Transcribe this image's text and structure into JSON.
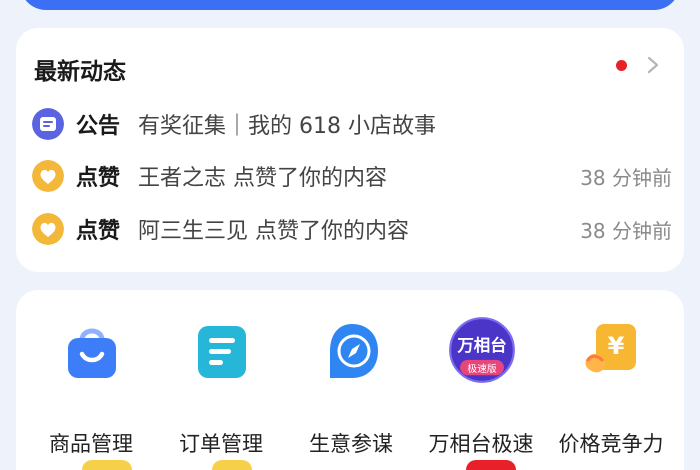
{
  "activity": {
    "title": "最新动态",
    "items": [
      {
        "tag": "公告",
        "text": "有奖征集｜我的 618 小店故事",
        "time": "",
        "icon": "announcement-icon"
      },
      {
        "tag": "点赞",
        "text": "王者之志 点赞了你的内容",
        "time": "38 分钟前",
        "icon": "heart-icon"
      },
      {
        "tag": "点赞",
        "text": "阿三生三见 点赞了你的内容",
        "time": "38 分钟前",
        "icon": "heart-icon"
      }
    ]
  },
  "tools": [
    {
      "label": "商品管理",
      "icon": "shopping-bag-icon"
    },
    {
      "label": "订单管理",
      "icon": "order-list-icon"
    },
    {
      "label": "生意参谋",
      "icon": "compass-icon"
    },
    {
      "label": "万相台极速",
      "icon": "wanxiangtai-icon",
      "icon_text": "万相台",
      "icon_badge": "极速版"
    },
    {
      "label": "价格竞争力",
      "icon": "price-tag-icon",
      "icon_text": "¥"
    }
  ],
  "colors": {
    "brand_blue": "#3d6ff5",
    "announce_purple": "#5a63e0",
    "like_yellow": "#f3b83a",
    "dot_red": "#e8202a"
  }
}
